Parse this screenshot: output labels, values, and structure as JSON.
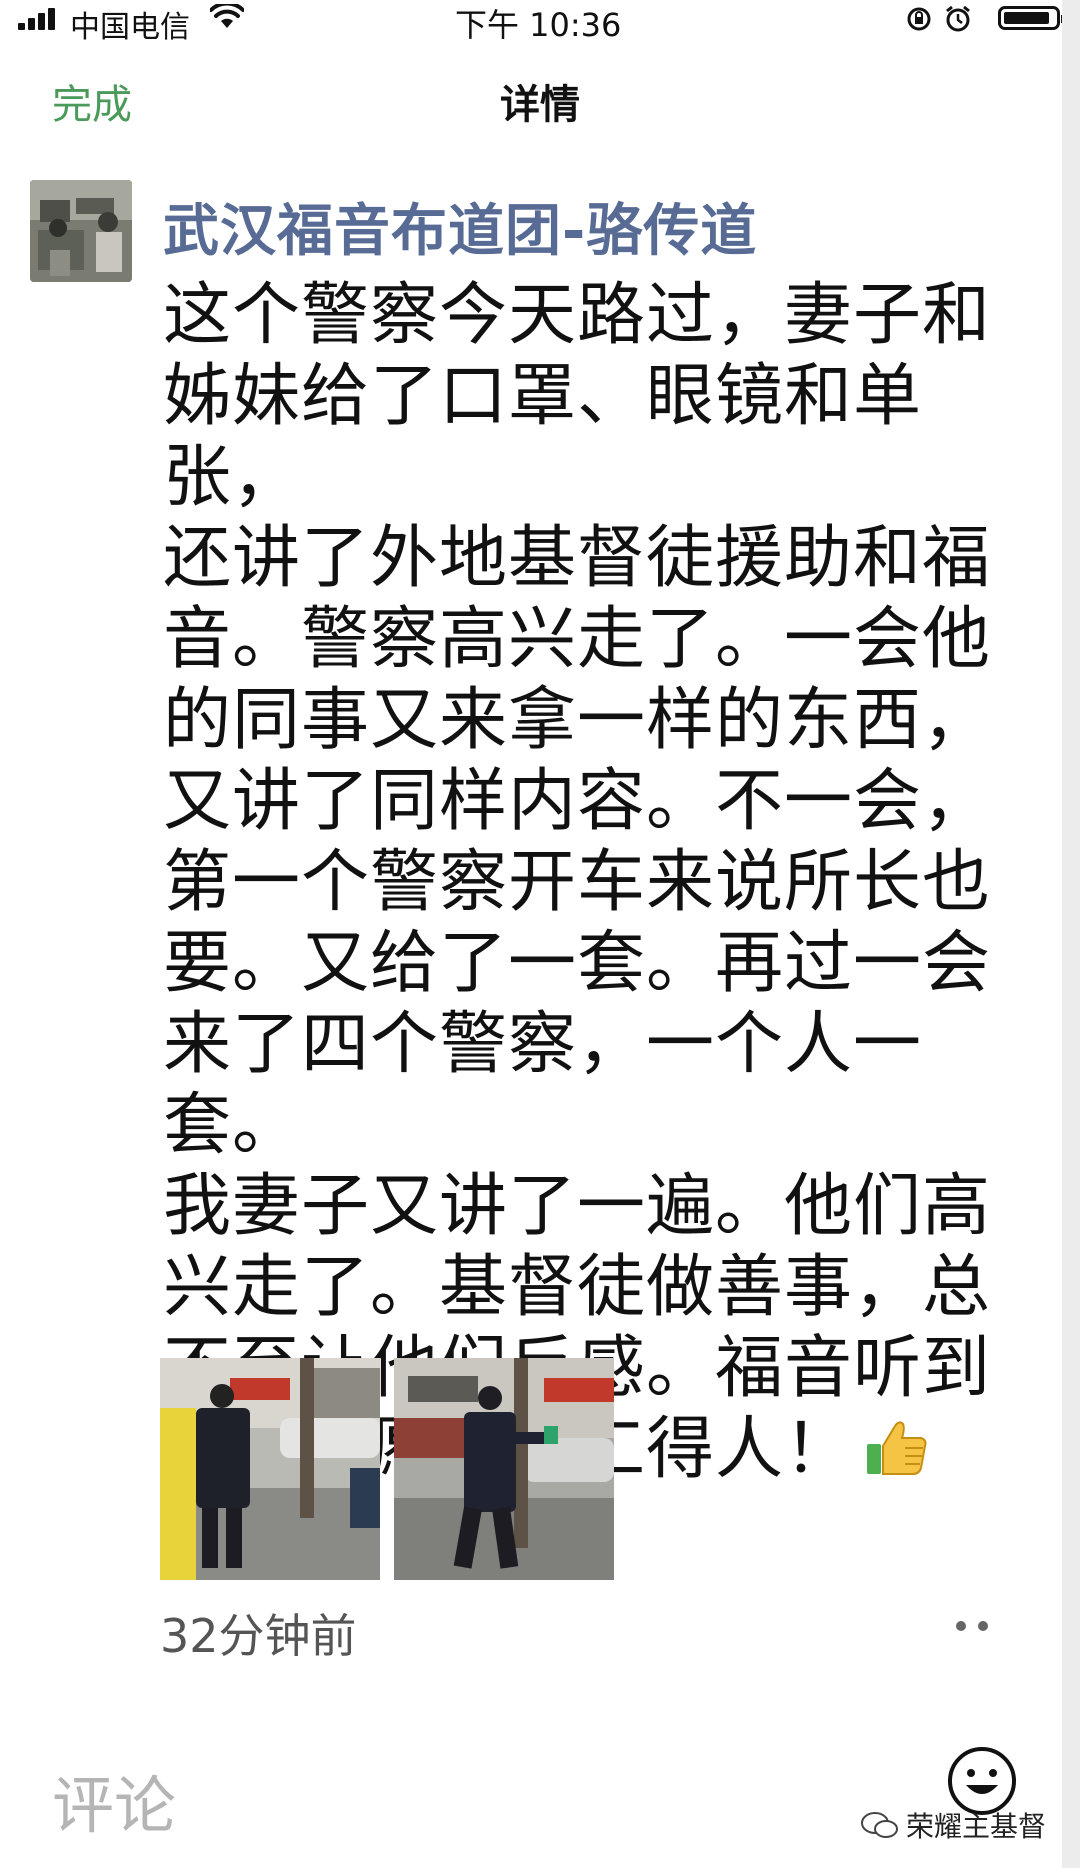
{
  "status_bar": {
    "carrier": "中国电信",
    "time": "下午 10:36",
    "battery_level": 0.9
  },
  "nav": {
    "done_label": "完成",
    "title": "详情"
  },
  "post": {
    "author": "武汉福音布道团-骆传道",
    "body_lines": [
      "这个警察今天路过，妻子和",
      "姊妹给了口罩、眼镜和单张，",
      "还讲了外地基督徒援助和福",
      "音。警察高兴走了。一会他",
      "的同事又来拿一样的东西，",
      "又讲了同样内容。不一会，",
      "第一个警察开车来说所长也",
      "要。又给了一套。再过一会",
      "来了四个警察，一个人一套。",
      "我妻子又讲了一遍。他们高",
      "兴走了。基督徒做善事，总",
      "不至让他们反感。福音听到",
      "了。但愿神开工得人！"
    ],
    "emoji": "thumbs-up-icon",
    "photos": [
      "photo-police-1",
      "photo-police-2"
    ],
    "timestamp": "32分钟前"
  },
  "comment": {
    "label": "评论"
  },
  "watermark": {
    "text": "荣耀主基督"
  },
  "colors": {
    "accent_green": "#4a9a5b",
    "author_blue": "#576b95"
  }
}
